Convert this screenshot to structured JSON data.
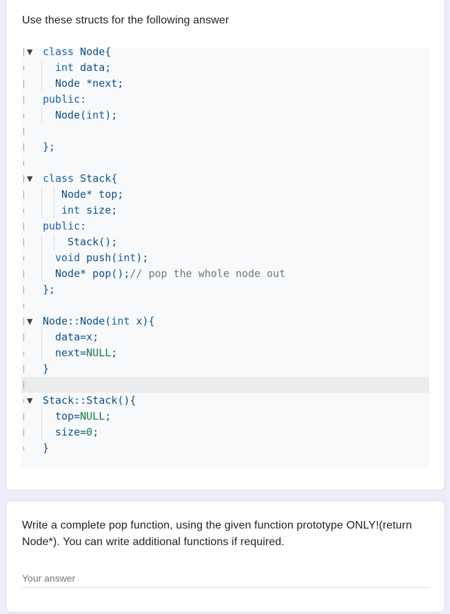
{
  "question1": {
    "title": "Use these structs for the following answer",
    "code_lines": [
      {
        "indent": 0,
        "fold": true,
        "tokens": [
          {
            "t": "class",
            "c": "kw"
          },
          {
            "t": " Node{",
            "c": "pl"
          }
        ]
      },
      {
        "indent": 1,
        "fold": false,
        "tokens": [
          {
            "t": "int",
            "c": "ty"
          },
          {
            "t": " data;",
            "c": "pl"
          }
        ]
      },
      {
        "indent": 1,
        "fold": false,
        "tokens": [
          {
            "t": "Node",
            "c": "pl"
          },
          {
            "t": " *next;",
            "c": "pl"
          }
        ]
      },
      {
        "indent": 0,
        "fold": false,
        "tokens": [
          {
            "t": "public:",
            "c": "kw"
          }
        ]
      },
      {
        "indent": 1,
        "fold": false,
        "tokens": [
          {
            "t": "Node(",
            "c": "fn"
          },
          {
            "t": "int",
            "c": "ty"
          },
          {
            "t": ");",
            "c": "pl"
          }
        ]
      },
      {
        "indent": 0,
        "fold": false,
        "tokens": []
      },
      {
        "indent": 0,
        "fold": false,
        "tokens": [
          {
            "t": "};",
            "c": "pl"
          }
        ]
      },
      {
        "indent": 0,
        "fold": false,
        "tokens": []
      },
      {
        "indent": 0,
        "fold": true,
        "tokens": [
          {
            "t": "class",
            "c": "kw"
          },
          {
            "t": " Stack{",
            "c": "pl"
          }
        ]
      },
      {
        "indent": 1.5,
        "fold": false,
        "tokens": [
          {
            "t": "Node*",
            "c": "pl"
          },
          {
            "t": " top;",
            "c": "pl"
          }
        ]
      },
      {
        "indent": 1.5,
        "fold": false,
        "tokens": [
          {
            "t": "int",
            "c": "ty"
          },
          {
            "t": " size;",
            "c": "pl"
          }
        ]
      },
      {
        "indent": 0,
        "fold": false,
        "tokens": [
          {
            "t": "public:",
            "c": "kw"
          }
        ]
      },
      {
        "indent": 2,
        "fold": false,
        "tokens": [
          {
            "t": "Stack(",
            "c": "fn"
          },
          {
            "t": ");",
            "c": "pl"
          }
        ]
      },
      {
        "indent": 1,
        "fold": false,
        "tokens": [
          {
            "t": "void",
            "c": "ty"
          },
          {
            "t": " push(",
            "c": "fn"
          },
          {
            "t": "int",
            "c": "ty"
          },
          {
            "t": ");",
            "c": "pl"
          }
        ]
      },
      {
        "indent": 1,
        "fold": false,
        "tokens": [
          {
            "t": "Node*",
            "c": "pl"
          },
          {
            "t": " pop(",
            "c": "fn"
          },
          {
            "t": ");",
            "c": "pl"
          },
          {
            "t": "// pop the whole node out",
            "c": "cm"
          }
        ]
      },
      {
        "indent": 0,
        "fold": false,
        "tokens": [
          {
            "t": "};",
            "c": "pl"
          }
        ]
      },
      {
        "indent": 0,
        "fold": false,
        "tokens": []
      },
      {
        "indent": 0,
        "fold": true,
        "tokens": [
          {
            "t": "Node::Node(",
            "c": "fn"
          },
          {
            "t": "int",
            "c": "ty"
          },
          {
            "t": " x){",
            "c": "pl"
          }
        ]
      },
      {
        "indent": 1,
        "fold": false,
        "tokens": [
          {
            "t": "data=x;",
            "c": "pl"
          }
        ]
      },
      {
        "indent": 1,
        "fold": false,
        "tokens": [
          {
            "t": "next=",
            "c": "pl"
          },
          {
            "t": "NULL",
            "c": "nb"
          },
          {
            "t": ";",
            "c": "pl"
          }
        ]
      },
      {
        "indent": 0,
        "fold": false,
        "tokens": [
          {
            "t": "}",
            "c": "pl"
          }
        ]
      },
      {
        "indent": 0,
        "fold": false,
        "hl": true,
        "tokens": []
      },
      {
        "indent": 0,
        "fold": true,
        "tokens": [
          {
            "t": "Stack::Stack(",
            "c": "fn"
          },
          {
            "t": "){",
            "c": "pl"
          }
        ]
      },
      {
        "indent": 1,
        "fold": false,
        "tokens": [
          {
            "t": "top=",
            "c": "pl"
          },
          {
            "t": "NULL",
            "c": "nb"
          },
          {
            "t": ";",
            "c": "pl"
          }
        ]
      },
      {
        "indent": 1,
        "fold": false,
        "tokens": [
          {
            "t": "size=",
            "c": "pl"
          },
          {
            "t": "0",
            "c": "nb"
          },
          {
            "t": ";",
            "c": "pl"
          }
        ]
      },
      {
        "indent": 0,
        "fold": false,
        "tokens": [
          {
            "t": "}",
            "c": "pl"
          }
        ]
      }
    ]
  },
  "question2": {
    "title_line1": "Write a complete pop function, using the given function prototype ONLY!(return",
    "title_line2": "Node*).  You can write additional functions if required.",
    "answer_placeholder": "Your answer",
    "answer_value": ""
  },
  "colors": {
    "page_background": "#f0ebf8",
    "card_background": "#ffffff",
    "code_background": "#f8f9fa",
    "keyword": "#1a5fb4",
    "number_literal": "#0b8043",
    "comment": "#6f7780"
  },
  "icons": {
    "fold_marker": "triangle-down-icon"
  }
}
